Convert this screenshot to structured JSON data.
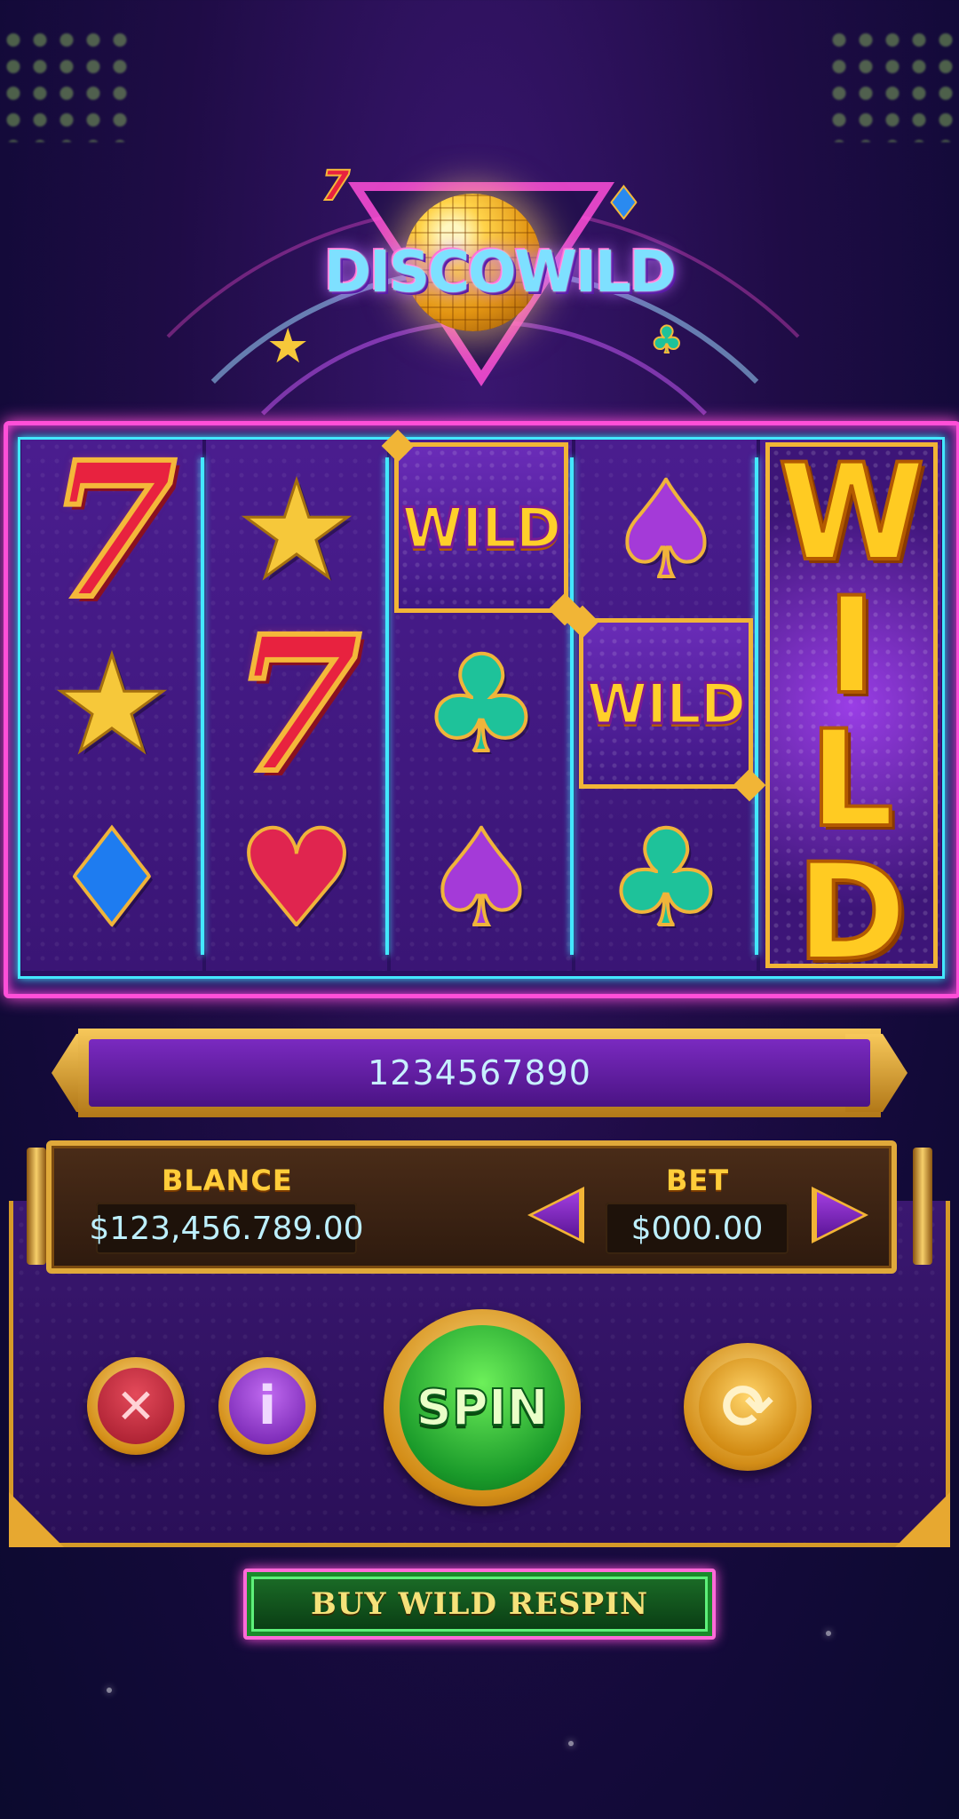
{
  "game": {
    "logo_text": "DISCOWILD"
  },
  "reels": [
    [
      "seven",
      "star",
      "diamond"
    ],
    [
      "star",
      "seven",
      "heart"
    ],
    [
      "wild",
      "club",
      "spade"
    ],
    [
      "spade",
      "wild",
      "club"
    ],
    [
      "wild-expanded"
    ]
  ],
  "symbols": {
    "seven": "7",
    "star": "★",
    "diamond": "♦",
    "heart": "♥",
    "spade": "♠",
    "club": "♣",
    "wild": "WILD"
  },
  "expanded_wild_letters": [
    "W",
    "I",
    "L",
    "D"
  ],
  "message_bar": {
    "text": "1234567890"
  },
  "balance": {
    "label": "BLANCE",
    "value": "$123,456.789.00"
  },
  "bet": {
    "label": "BET",
    "value": "$000.00"
  },
  "controls": {
    "close_glyph": "✕",
    "info_glyph": "i",
    "spin_label": "SPIN",
    "autoplay_glyph": "⟳"
  },
  "buy_button": {
    "label": "BUY WILD RESPIN"
  },
  "colors": {
    "neon_pink": "#ff4fd8",
    "neon_cyan": "#43e8ff",
    "gold": "#f1b536",
    "spin_green": "#1a9a2a"
  }
}
